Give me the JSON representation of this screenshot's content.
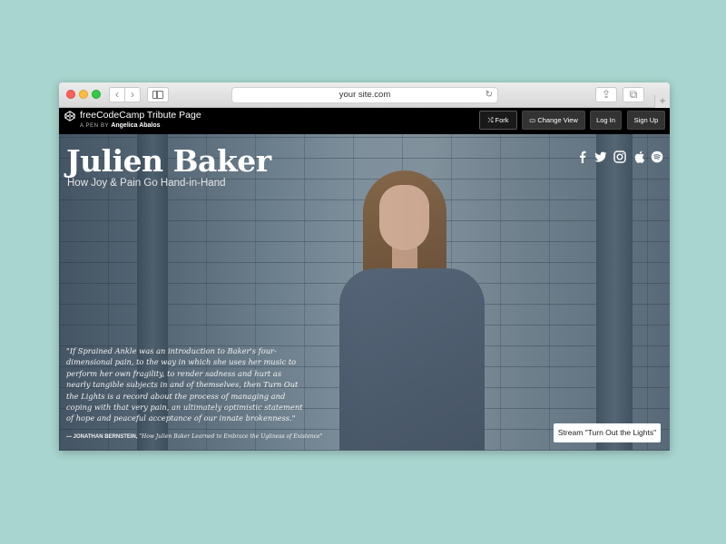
{
  "browser": {
    "url": "your site.com",
    "back_glyph": "‹",
    "forward_glyph": "›",
    "reload_glyph": "↻",
    "share_glyph": "⇪",
    "tabs_glyph": "⧉",
    "plus_glyph": "+"
  },
  "codepen": {
    "title": "freeCodeCamp Tribute Page",
    "byline_prefix": "A PEN BY",
    "author": "Angelica Abalos",
    "buttons": {
      "fork": "⤭ Fork",
      "change_view": "▭ Change View",
      "login": "Log In",
      "signup": "Sign Up"
    }
  },
  "hero": {
    "title": "Julien Baker",
    "subtitle": "How Joy & Pain Go Hand-in-Hand",
    "quote": "\"If Sprained Ankle was an introduction to Baker's four-dimensional pain, to the way in which she uses her music to perform her own fragility, to render sadness and hurt as nearly tangible subjects in and of themselves, then Turn Out the Lights is a record about the process of managing and coping with that very pain, an ultimately optimistic statement of hope and peaceful acceptance of our innate brokenness.\"",
    "attribution_author": "— JONATHAN BERNSTEIN,",
    "attribution_source": "\"How Julien Baker Learned to Embrace the Ugliness of Existence\"",
    "stream_button": "Stream \"Turn Out the Lights\""
  },
  "social_icons": [
    "facebook-icon",
    "twitter-icon",
    "instagram-icon",
    "apple-icon",
    "spotify-icon"
  ],
  "colors": {
    "background": "#a8d5cf",
    "header": "#000000",
    "accent_text": "#ffffff"
  }
}
